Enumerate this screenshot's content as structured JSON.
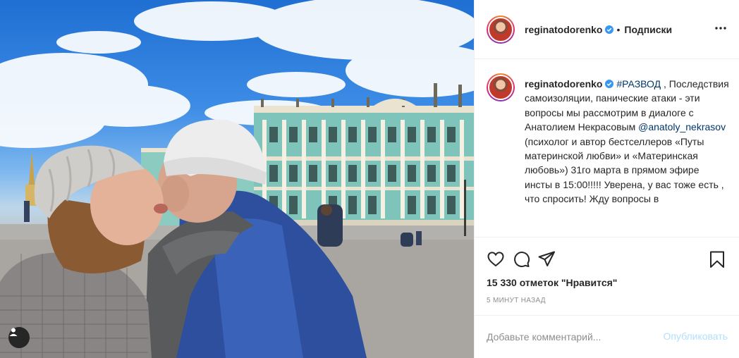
{
  "post": {
    "author": "reginatodorenko",
    "separator": "•",
    "follow_label": "Подписки",
    "more_icon": "more-horizontal-icon",
    "caption": {
      "hashtag": "#РАЗВОД",
      "text_1": " , Последствия самоизоляции, панические атаки - эти вопросы мы рассмотрим в диалоге с Анатолием Некрасовым ",
      "mention": "@anatoly_nekrasov",
      "text_2": " (психолог и автор бестселлеров «Путы материнской любви» и «Материнская любовь») 31го марта в прямом эфире инсты в 15:00!!!!! Уверена, у вас тоже есть , что спросить! Жду вопросы в"
    },
    "likes": "15 330 отметок \"Нравится\"",
    "time": "5 МИНУТ НАЗАД",
    "comment": {
      "placeholder": "Добавьте комментарий...",
      "publish_label": "Опубликовать"
    }
  },
  "icons": {
    "like": "heart-icon",
    "comment": "comment-icon",
    "share": "share-icon",
    "save": "bookmark-icon",
    "verified": "verified-badge-icon",
    "tag": "user-tag-icon"
  },
  "colors": {
    "verified": "#3897f0",
    "link": "#00376b",
    "publish_disabled": "#b2dffc",
    "muted": "#8e8e8e"
  }
}
